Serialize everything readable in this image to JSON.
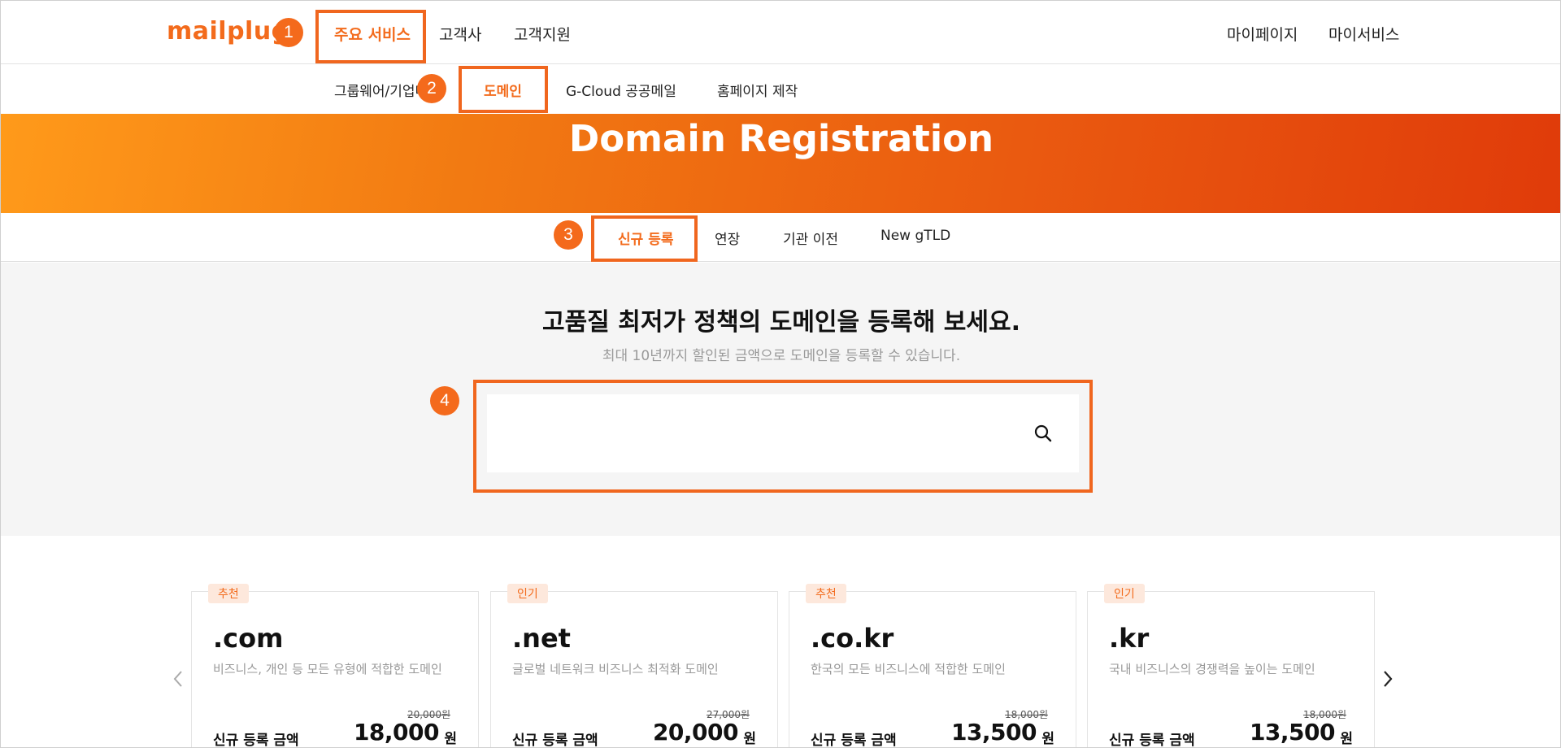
{
  "header": {
    "logo": "mailplug",
    "nav": [
      "주요 서비스",
      "고객사",
      "고객지원"
    ],
    "user_nav": [
      "마이페이지",
      "마이서비스"
    ]
  },
  "subnav": [
    "그룹웨어/기업메일",
    "도메인",
    "G-Cloud 공공메일",
    "홈페이지 제작"
  ],
  "hero": {
    "title": "Domain Registration"
  },
  "tabs": [
    "신규 등록",
    "연장",
    "기관 이전",
    "New gTLD"
  ],
  "search": {
    "headline": "고품질 최저가 정책의 도메인을 등록해 보세요.",
    "subline": "최대 10년까지 할인된 금액으로 도메인을 등록할 수 있습니다.",
    "placeholder": ""
  },
  "markers": [
    "1",
    "2",
    "3",
    "4"
  ],
  "cards": [
    {
      "badge": "추천",
      "name": ".com",
      "desc": "비즈니스, 개인 등 모든 유형에 적합한 도메인",
      "label": "신규 등록 금액",
      "original_price": "20,000원",
      "price": "18,000",
      "currency": "원"
    },
    {
      "badge": "인기",
      "name": ".net",
      "desc": "글로벌 네트워크 비즈니스 최적화 도메인",
      "label": "신규 등록 금액",
      "original_price": "27,000원",
      "price": "20,000",
      "currency": "원"
    },
    {
      "badge": "추천",
      "name": ".co.kr",
      "desc": "한국의 모든 비즈니스에 적합한 도메인",
      "label": "신규 등록 금액",
      "original_price": "18,000원",
      "price": "13,500",
      "currency": "원"
    },
    {
      "badge": "인기",
      "name": ".kr",
      "desc": "국내 비즈니스의 경쟁력을 높이는 도메인",
      "label": "신규 등록 금액",
      "original_price": "18,000원",
      "price": "13,500",
      "currency": "원"
    }
  ],
  "colors": {
    "accent": "#f36b1c",
    "hero_start": "#ff9a1a",
    "hero_end": "#e03b0a"
  },
  "icons": [
    "search-icon",
    "chevron-left-icon",
    "chevron-right-icon"
  ]
}
